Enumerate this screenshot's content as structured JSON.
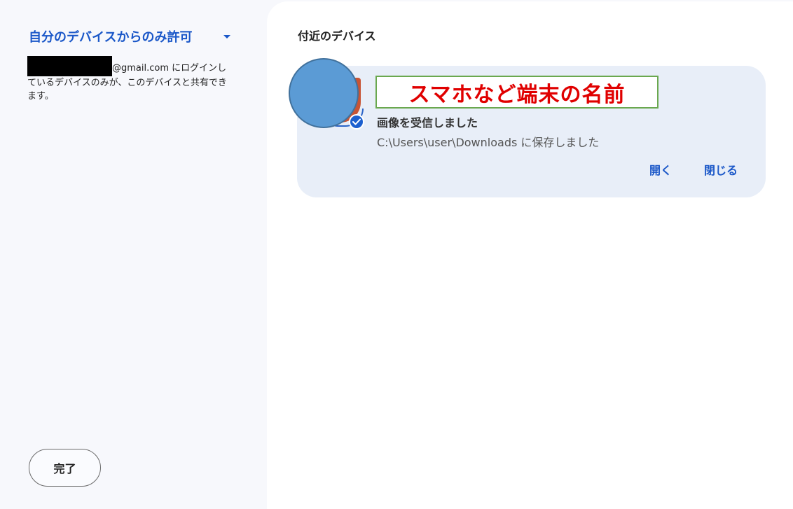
{
  "sidebar": {
    "visibility": {
      "label": "自分のデバイスからのみ許可",
      "icon": "arrow-drop-down-icon"
    },
    "description": {
      "email_suffix": "@gmail.com",
      "text_1": " にログインし",
      "text_2": "ているデバイスのみが、このデバイスと共有でき",
      "text_3": "ます。"
    },
    "done_label": "完了"
  },
  "main": {
    "section_title": "付近のデバイス",
    "card": {
      "device_name": "スマホなど端末の名前",
      "status": "画像を受信しました",
      "save_path": "C:\\Users\\user\\Downloads に保存しました",
      "open_label": "開く",
      "close_label": "閉じる",
      "badge_icon": "check-circle-icon"
    }
  },
  "colors": {
    "accent": "#1a57c8",
    "card_bg": "#e8eef8",
    "device_name": "#e00000",
    "name_border": "#6aa84f"
  }
}
